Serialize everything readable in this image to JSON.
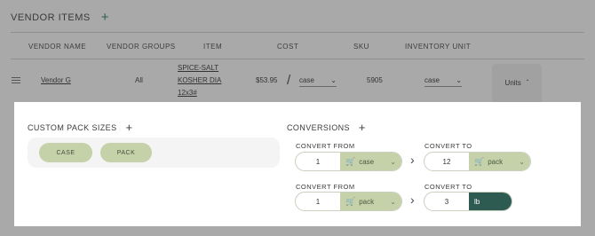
{
  "header": {
    "title": "VENDOR ITEMS",
    "add_icon": "plus-icon"
  },
  "table": {
    "columns": [
      "VENDOR NAME",
      "VENDOR GROUPS",
      "ITEM",
      "COST",
      "SKU",
      "INVENTORY UNIT"
    ],
    "row": {
      "vendor_name": "Vendor G",
      "vendor_groups": "All",
      "item_lines": [
        "SPICE-SALT",
        "KOSHER DIA",
        "12x3#"
      ],
      "cost": "$53.95",
      "cost_unit": "case",
      "sku": "5905",
      "inventory_unit": "case",
      "units_button": "Units"
    }
  },
  "custom_pack": {
    "title": "CUSTOM PACK SIZES",
    "packs": [
      "CASE",
      "PACK"
    ]
  },
  "conversions": {
    "title": "CONVERSIONS",
    "rows": [
      {
        "from_label": "CONVERT FROM",
        "from_qty": "1",
        "from_unit": "case",
        "to_label": "CONVERT TO",
        "to_qty": "12",
        "to_unit": "pack"
      },
      {
        "from_label": "CONVERT FROM",
        "from_qty": "1",
        "from_unit": "pack",
        "to_label": "CONVERT TO",
        "to_qty": "3",
        "to_unit": "lb"
      }
    ]
  },
  "colors": {
    "accent": "#2d5b52",
    "pill": "#c5d1a8",
    "overlay": "#a9a9a9"
  }
}
